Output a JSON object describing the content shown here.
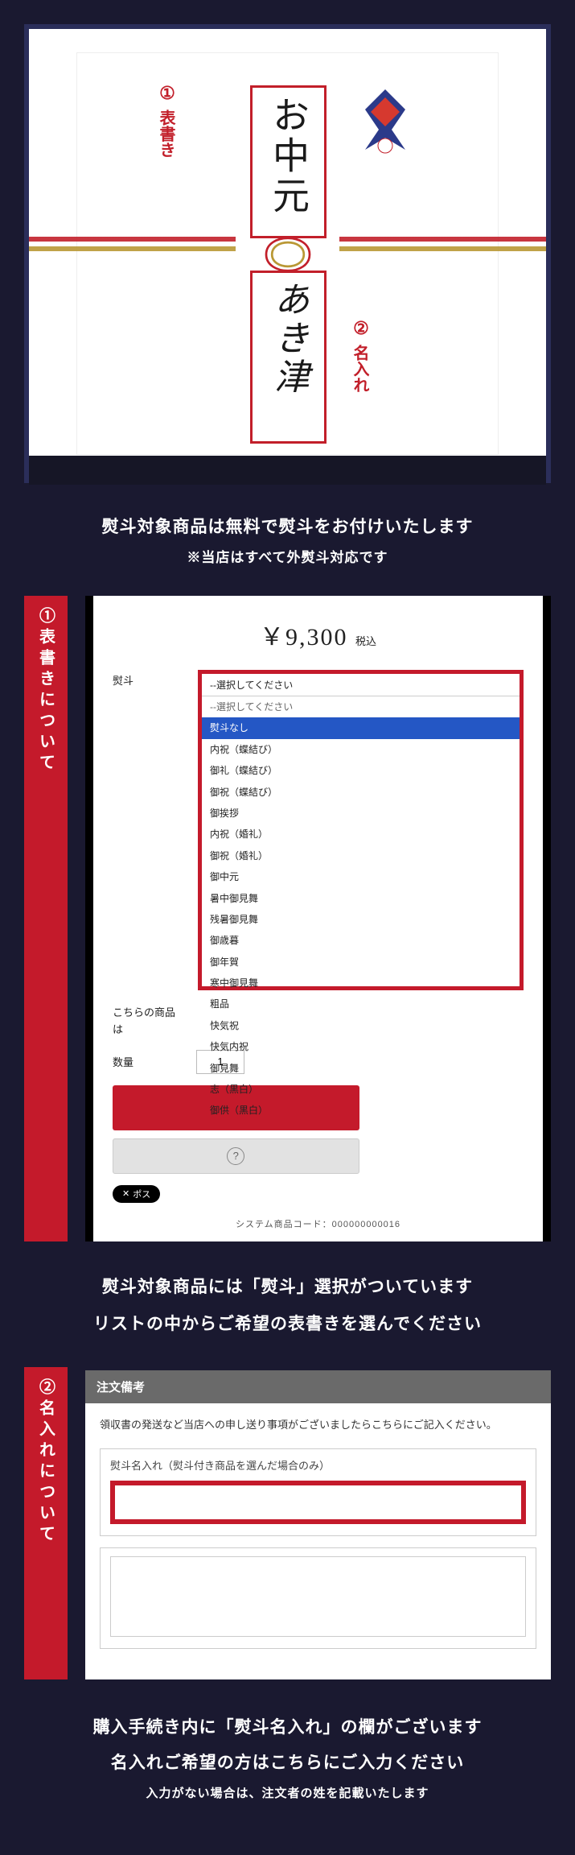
{
  "noshi": {
    "top_text": "お中元",
    "bottom_text": "あき津",
    "anno1_num": "①",
    "anno1_label": "表書き",
    "anno2_num": "②",
    "anno2_label": "名入れ"
  },
  "caption": {
    "line1": "熨斗対象商品は無料で熨斗をお付けいたします",
    "line2": "※当店はすべて外熨斗対応です"
  },
  "section1": {
    "tab": "①表書きについて",
    "price": "￥9,300",
    "taxin": "税込",
    "label_noshi": "熨斗",
    "label_product": "こちらの商品は",
    "label_qty": "数量",
    "qty_value": "1",
    "select_head": "--選択してください",
    "options": [
      "--選択してください",
      "熨斗なし",
      "内祝（蝶結び）",
      "御礼（蝶結び）",
      "御祝（蝶結び）",
      "御挨拶",
      "内祝（婚礼）",
      "御祝（婚礼）",
      "御中元",
      "暑中御見舞",
      "残暑御見舞",
      "御歳暮",
      "御年賀",
      "寒中御見舞",
      "粗品",
      "快気祝",
      "快気内祝",
      "御見舞",
      "志（黒白）",
      "御供（黒白）"
    ],
    "selected_index": 1,
    "pill_label": "ポス",
    "syscode_label": "システム商品コード：",
    "syscode_value": "000000000016",
    "caption_l1": "熨斗対象商品には「熨斗」選択がついています",
    "caption_l2": "リストの中からご希望の表書きを選んでください"
  },
  "section2": {
    "tab": "②名入れについて",
    "head": "注文備考",
    "note": "領収書の発送など当店への申し送り事項がございましたらこちらにご記入ください。",
    "field_label": "熨斗名入れ（熨斗付き商品を選んだ場合のみ）",
    "cap_l1": "購入手続き内に「熨斗名入れ」の欄がございます",
    "cap_l2": "名入れご希望の方はこちらにご入力ください",
    "cap_l3": "入力がない場合は、注文者の姓を記載いたします"
  }
}
